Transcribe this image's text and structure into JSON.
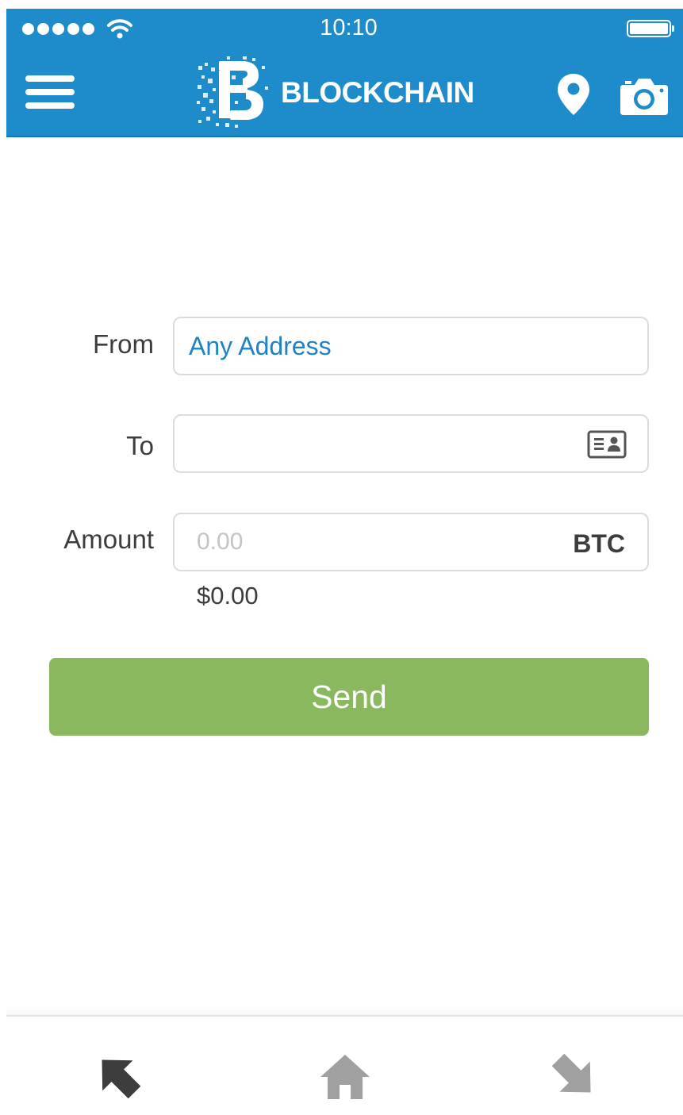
{
  "status_bar": {
    "time": "10:10",
    "signal_icon": "signal-dots-icon",
    "wifi_icon": "wifi-icon",
    "battery_icon": "battery-icon"
  },
  "header": {
    "menu_icon": "hamburger-menu-icon",
    "logo_text": "BLOCKCHAIN",
    "location_icon": "location-pin-icon",
    "camera_icon": "camera-icon"
  },
  "form": {
    "from_label": "From",
    "from_value": "Any Address",
    "to_label": "To",
    "to_value": "",
    "to_icon": "address-book-icon",
    "amount_label": "Amount",
    "amount_placeholder": "0.00",
    "amount_value": "",
    "currency": "BTC",
    "fiat_value": "$0.00"
  },
  "send_button": {
    "label": "Send"
  },
  "tabbar": {
    "tabs": [
      {
        "icon": "send-arrow-icon",
        "active": true
      },
      {
        "icon": "home-icon",
        "active": false
      },
      {
        "icon": "receive-arrow-icon",
        "active": false
      }
    ]
  },
  "colors": {
    "header_blue": "#1e8ccb",
    "link_blue": "#1e82c6",
    "send_green": "#8ab85e",
    "active_tab": "#3d3d3d",
    "inactive_tab": "#a0a0a0"
  }
}
